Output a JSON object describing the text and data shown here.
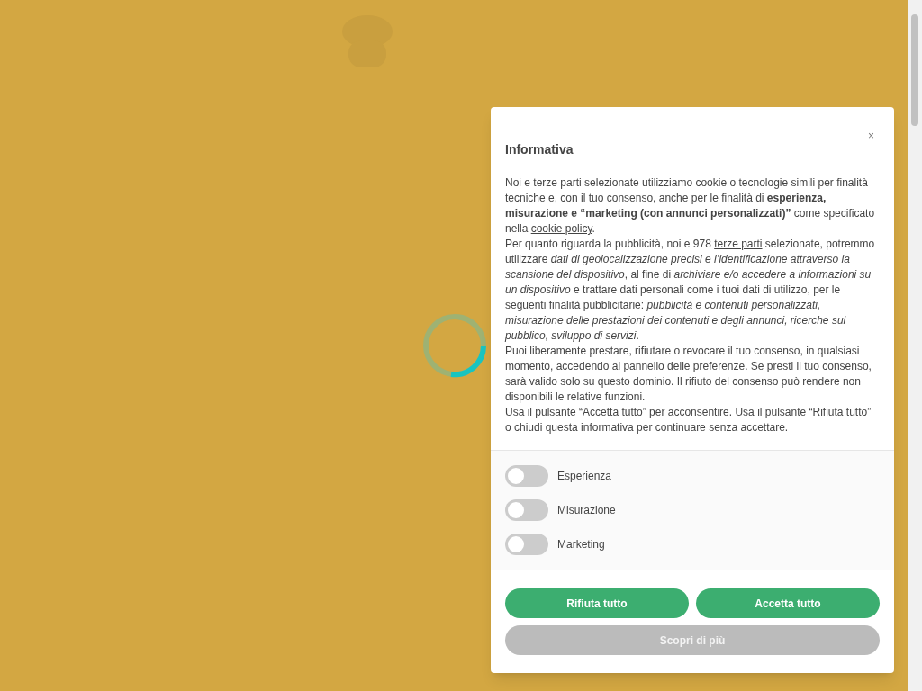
{
  "dialog": {
    "title": "Informativa",
    "close": "×",
    "paragraphs": [
      [
        {
          "kind": "text",
          "text": "Noi e terze parti selezionate utilizziamo cookie o tecnologie simili per finalità tecniche e, con il tuo consenso, anche per le finalità di **esperienza, misurazione e “marketing (con annunci personalizzati)”** come specificato nella "
        },
        {
          "kind": "link",
          "text": "cookie policy"
        },
        {
          "kind": "text",
          "text": "."
        }
      ],
      [
        {
          "kind": "text",
          "text": "Per quanto riguarda la pubblicità, noi e 978 "
        },
        {
          "kind": "link",
          "text": "terze parti"
        },
        {
          "kind": "text",
          "text": " selezionate, potremmo utilizzare *dati di geolocalizzazione precisi e l’identificazione attraverso la scansione del dispositivo*, al fine di *archiviare e/o accedere a informazioni su un dispositivo* e trattare dati personali come i tuoi dati di utilizzo, per le seguenti "
        },
        {
          "kind": "link",
          "text": "finalità pubblicitarie"
        },
        {
          "kind": "text",
          "text": ": *pubblicità e contenuti personalizzati, misurazione delle prestazioni dei contenuti e degli annunci, ricerche sul pubblico, sviluppo di servizi*."
        }
      ],
      [
        {
          "kind": "text",
          "text": "Puoi liberamente prestare, rifiutare o revocare il tuo consenso, in qualsiasi momento, accedendo al pannello delle preferenze. Se presti il tuo consenso, sarà valido solo su questo dominio. Il rifiuto del consenso può rendere non disponibili le relative funzioni."
        }
      ],
      [
        {
          "kind": "text",
          "text": "Usa il pulsante “Accetta tutto” per acconsentire. Usa il pulsante “Rifiuta tutto” o chiudi questa informativa per continuare senza accettare."
        }
      ]
    ],
    "toggles": [
      {
        "label": "Esperienza",
        "on": false
      },
      {
        "label": "Misurazione",
        "on": false
      },
      {
        "label": "Marketing",
        "on": false
      }
    ],
    "buttons": [
      {
        "label": "Rifiuta tutto",
        "kind": "primary"
      },
      {
        "label": "Accetta tutto",
        "kind": "primary"
      },
      {
        "label": "Scopri di più",
        "kind": "secondary"
      }
    ]
  }
}
